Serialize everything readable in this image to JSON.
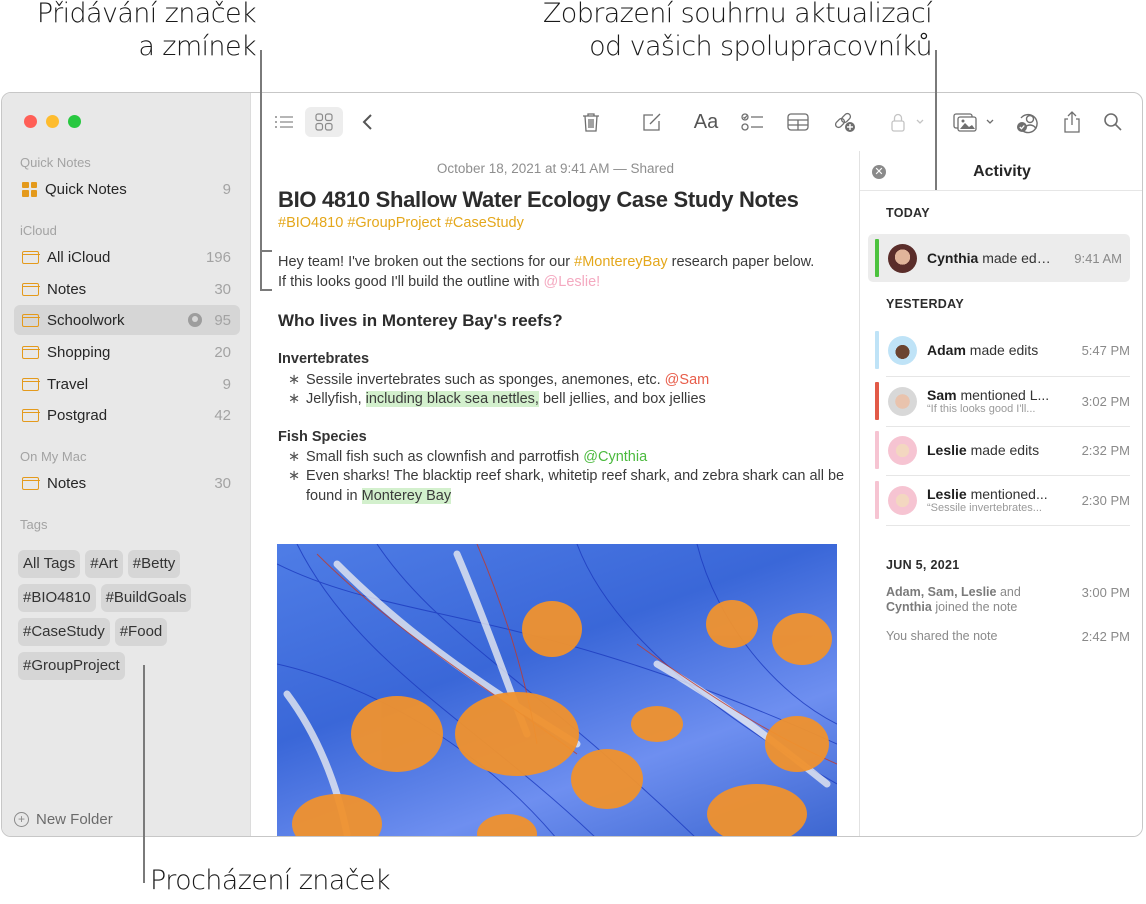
{
  "callouts": {
    "top_left": [
      "Přidávání značek",
      "a zmínek"
    ],
    "top_right": [
      "Zobrazení souhrnu aktualizací",
      "od vašich spolupracovníků"
    ],
    "bottom": "Procházení značek"
  },
  "window_controls": {
    "close": "#ff5f57",
    "minimize": "#febc2e",
    "zoom": "#28c840"
  },
  "sidebar": {
    "sections": {
      "quick_notes": "Quick Notes",
      "icloud": "iCloud",
      "on_my_mac": "On My Mac",
      "tags": "Tags"
    },
    "quick_notes_item": {
      "label": "Quick Notes",
      "count": "9"
    },
    "icloud_items": [
      {
        "label": "All iCloud",
        "count": "196"
      },
      {
        "label": "Notes",
        "count": "30"
      },
      {
        "label": "Schoolwork",
        "count": "95",
        "shared": true,
        "selected": true
      },
      {
        "label": "Shopping",
        "count": "20"
      },
      {
        "label": "Travel",
        "count": "9"
      },
      {
        "label": "Postgrad",
        "count": "42"
      }
    ],
    "mac_items": [
      {
        "label": "Notes",
        "count": "30"
      }
    ],
    "tags": [
      "All Tags",
      "#Art",
      "#Betty",
      "#BIO4810",
      "#BuildGoals",
      "#CaseStudy",
      "#Food",
      "#GroupProject"
    ],
    "new_folder": "New Folder"
  },
  "toolbar": {
    "icons": [
      "list-view",
      "gallery-view",
      "back",
      "delete",
      "compose",
      "format",
      "checklist",
      "table",
      "collaborate-link",
      "lock",
      "media",
      "collaboration",
      "share",
      "search"
    ],
    "format_label": "Aa"
  },
  "note": {
    "meta": "October 18, 2021 at 9:41 AM — Shared",
    "title": "BIO 4810 Shallow Water Ecology Case Study Notes",
    "tags": "#BIO4810 #GroupProject #CaseStudy",
    "intro": {
      "part1": "Hey team! I've broken out the sections for our ",
      "tag": "#MontereyBay",
      "part2": " research paper below. If this looks good I'll build the outline with ",
      "mention": "@Leslie!"
    },
    "heading": "Who lives in Monterey Bay's reefs?",
    "sections": [
      {
        "title": "Invertebrates",
        "bullets": [
          {
            "text": "Sessile invertebrates such as sponges, anemones, etc. ",
            "mention": "@Sam"
          },
          {
            "pre": "Jellyfish, ",
            "highlight": "including black sea nettles,",
            "post": " bell jellies, and box jellies"
          }
        ]
      },
      {
        "title": "Fish Species",
        "bullets": [
          {
            "text": "Small fish such as clownfish and parrotfish ",
            "mention": "@Cynthia"
          },
          {
            "pre": "Even sharks! The blacktip reef shark, whitetip reef shark, and zebra shark can all be found in ",
            "highlight": "Monterey Bay"
          }
        ]
      }
    ],
    "image_alt": "Jellyfish photo"
  },
  "activity": {
    "title": "Activity",
    "groups": [
      {
        "label": "TODAY",
        "items": [
          {
            "name": "Cynthia",
            "action": "made ed…",
            "time": "9:41 AM",
            "color": "#4cc23e",
            "selected": true
          }
        ]
      },
      {
        "label": "YESTERDAY",
        "items": [
          {
            "name": "Adam",
            "action": "made edits",
            "time": "5:47 PM",
            "color": "#bfe3f7"
          },
          {
            "name": "Sam",
            "action": "mentioned L...",
            "preview": "“If this looks good I'll...",
            "time": "3:02 PM",
            "color": "#e25a48"
          },
          {
            "name": "Leslie",
            "action": "made edits",
            "time": "2:32 PM",
            "color": "#f6c4d2"
          },
          {
            "name": "Leslie",
            "action": "mentioned...",
            "preview": "“Sessile invertebrates...",
            "time": "2:30 PM",
            "color": "#f6c4d2"
          }
        ]
      }
    ],
    "history": {
      "label": "JUN 5, 2021",
      "items": [
        {
          "names": "Adam, Sam, Leslie",
          "joiner": " and ",
          "last": "Cynthia",
          "action": " joined the note",
          "time": "3:00 PM"
        },
        {
          "text": "You shared the note",
          "time": "2:42 PM"
        }
      ]
    }
  }
}
